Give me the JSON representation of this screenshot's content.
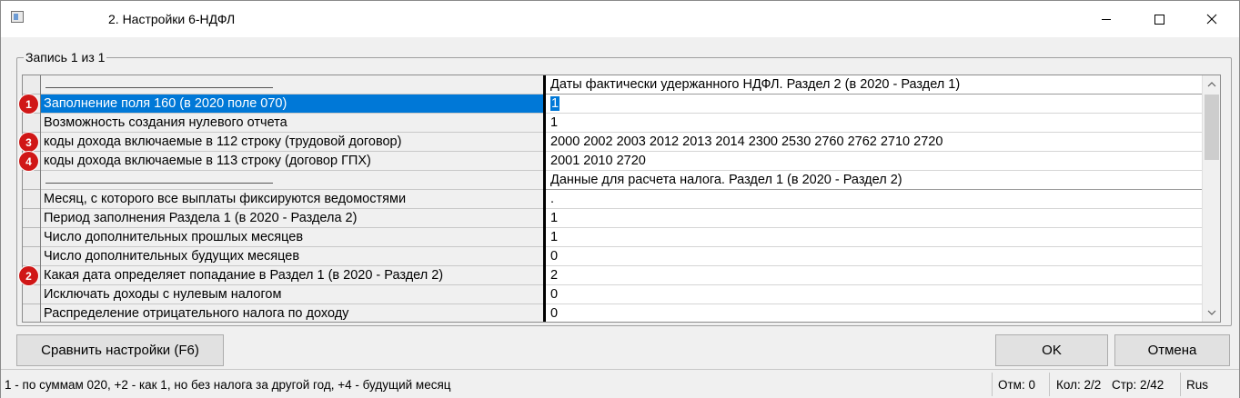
{
  "window": {
    "title": "2. Настройки 6-НДФЛ"
  },
  "record_label": "Запись 1 из 1",
  "grid": {
    "rows": [
      {
        "label": "",
        "value": "Даты фактически удержанного НДФЛ. Раздел 2 (в 2020 - Раздел 1)",
        "type": "header"
      },
      {
        "label": "Заполнение поля 160 (в 2020 поле 070)",
        "value": "1",
        "type": "selected",
        "marker": "1"
      },
      {
        "label": "Возможность создания нулевого отчета",
        "value": "1"
      },
      {
        "label": "коды дохода включаемые в 112 строку (трудовой договор)",
        "value": "2000 2002 2003 2012 2013 2014 2300 2530 2760 2762 2710 2720",
        "marker": "3"
      },
      {
        "label": "коды дохода включаемые в 113 строку (договор ГПХ)",
        "value": "2001 2010 2720",
        "marker": "4"
      },
      {
        "label": "",
        "value": "Данные для расчета налога.  Раздел 1 (в 2020 - Раздел 2)",
        "type": "header"
      },
      {
        "label": "Месяц, с которого все выплаты фиксируются ведомостями",
        "value": " ."
      },
      {
        "label": "Период заполнения Раздела 1 (в 2020 - Раздела 2)",
        "value": "1"
      },
      {
        "label": "Число дополнительных прошлых месяцев",
        "value": "1"
      },
      {
        "label": "Число дополнительных будущих месяцев",
        "value": "0"
      },
      {
        "label": "Какая дата определяет попадание в Раздел 1 (в 2020 - Раздел 2)",
        "value": "2",
        "marker": "2"
      },
      {
        "label": "Исключать доходы с нулевым налогом",
        "value": "0"
      },
      {
        "label": "Распределение отрицательного налога по доходу",
        "value": "0"
      }
    ]
  },
  "buttons": {
    "compare": "Сравнить настройки (F6)",
    "ok": "OK",
    "cancel": "Отмена"
  },
  "status": {
    "hint": "1 - по суммам 020, +2 - как 1, но без налога за другой год, +4 - будущий месяц",
    "marked": "Отм: 0",
    "col": "Кол: 2/2",
    "row": "Стр: 2/42",
    "lang": "Rus"
  },
  "colors": {
    "selection": "#0078d7",
    "marker": "#d01717"
  }
}
